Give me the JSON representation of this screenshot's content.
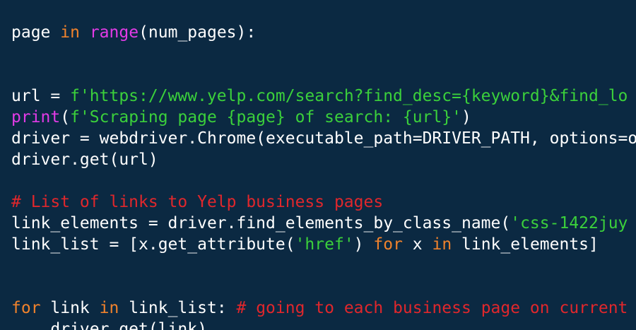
{
  "colors": {
    "background": "#0b2942",
    "default": "#ffffff",
    "keyword": "#f0822c",
    "builtin": "#e23be6",
    "string": "#3bd03b",
    "comment": "#e0272c"
  },
  "lines": [
    {
      "tokens": [
        {
          "t": "page ",
          "c": "default"
        },
        {
          "t": "in",
          "c": "keyword"
        },
        {
          "t": " ",
          "c": "default"
        },
        {
          "t": "range",
          "c": "builtin"
        },
        {
          "t": "(num_pages):",
          "c": "default"
        }
      ]
    },
    {
      "tokens": []
    },
    {
      "tokens": []
    },
    {
      "tokens": [
        {
          "t": "url = ",
          "c": "default"
        },
        {
          "t": "f'https://www.yelp.com/search?find_desc={keyword}&find_lo",
          "c": "string"
        }
      ]
    },
    {
      "tokens": [
        {
          "t": "print",
          "c": "builtin"
        },
        {
          "t": "(",
          "c": "default"
        },
        {
          "t": "f'Scraping page {page} of search: {url}'",
          "c": "string"
        },
        {
          "t": ")",
          "c": "default"
        }
      ]
    },
    {
      "tokens": [
        {
          "t": "driver = webdriver.Chrome(executable_path=DRIVER_PATH, options=o",
          "c": "default"
        }
      ]
    },
    {
      "tokens": [
        {
          "t": "driver.get(url)",
          "c": "default"
        }
      ]
    },
    {
      "tokens": []
    },
    {
      "tokens": [
        {
          "t": "# List of links to Yelp business pages",
          "c": "comment"
        }
      ]
    },
    {
      "tokens": [
        {
          "t": "link_elements = driver.find_elements_by_class_name(",
          "c": "default"
        },
        {
          "t": "'css-1422juy",
          "c": "string"
        }
      ]
    },
    {
      "tokens": [
        {
          "t": "link_list = [x.get_attribute(",
          "c": "default"
        },
        {
          "t": "'href'",
          "c": "string"
        },
        {
          "t": ") ",
          "c": "default"
        },
        {
          "t": "for",
          "c": "keyword"
        },
        {
          "t": " x ",
          "c": "default"
        },
        {
          "t": "in",
          "c": "keyword"
        },
        {
          "t": " link_elements]",
          "c": "default"
        }
      ]
    },
    {
      "tokens": []
    },
    {
      "tokens": []
    },
    {
      "tokens": [
        {
          "t": "for",
          "c": "keyword"
        },
        {
          "t": " link ",
          "c": "default"
        },
        {
          "t": "in",
          "c": "keyword"
        },
        {
          "t": " link_list: ",
          "c": "default"
        },
        {
          "t": "# going to each business page on current",
          "c": "comment"
        }
      ]
    },
    {
      "tokens": [
        {
          "t": "    driver.get(link)",
          "c": "default"
        }
      ]
    }
  ]
}
